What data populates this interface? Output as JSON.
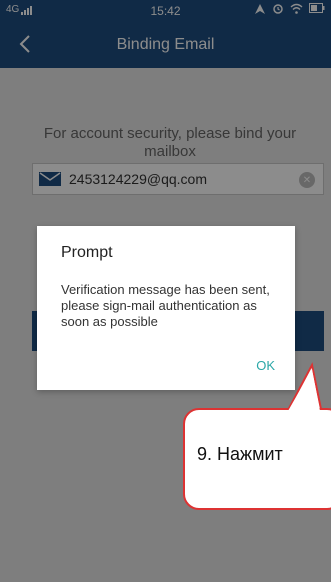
{
  "status_bar": {
    "network": "4G",
    "time": "15:42"
  },
  "header": {
    "title": "Binding Email",
    "back_icon": "chevron-left-icon"
  },
  "form": {
    "hint": "For account security, please bind your mailbox",
    "email_value": "2453124229@qq.com",
    "email_icon": "mail-icon",
    "clear_icon": "clear-icon"
  },
  "dialog": {
    "title": "Prompt",
    "message": "Verification message has been sent, please sign-mail authentication as soon as possible",
    "ok_label": "OK"
  },
  "callout": {
    "text": "9. Нажмит"
  },
  "colors": {
    "primary": "#1e4e80",
    "accent": "#2aa7a7",
    "callout_border": "#dd3333"
  }
}
